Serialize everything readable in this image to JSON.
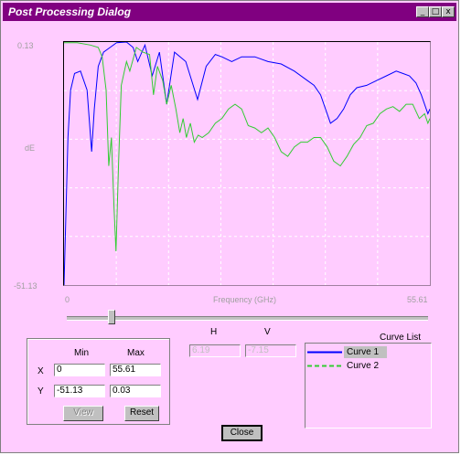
{
  "window": {
    "title": "Post Processing Dialog"
  },
  "titlebar_buttons": {
    "minimize": "_",
    "maximize": "□",
    "close": "x"
  },
  "plot": {
    "y_top_label": "0.13",
    "y_mid_label": "dE",
    "y_bottom_label": "-51.13",
    "x_left_label": "0",
    "x_title": "Frequency (GHz)",
    "x_right_label": "55.61",
    "colors": {
      "curve1": "#0000ff",
      "curve2": "#33cc33",
      "background": "#ffccff",
      "grid": "#ffffff"
    }
  },
  "chart_data": {
    "type": "line",
    "xlim": [
      0,
      55.61
    ],
    "ylim": [
      -51.13,
      0.13
    ],
    "grid": true,
    "series": [
      {
        "name": "Curve 1",
        "style": "solid",
        "color": "#0000ff",
        "points": [
          [
            0,
            -51.13
          ],
          [
            0.6,
            -20
          ],
          [
            1,
            -10
          ],
          [
            1.6,
            -6.5
          ],
          [
            2.5,
            -6
          ],
          [
            3.5,
            -10
          ],
          [
            4.2,
            -23
          ],
          [
            4.6,
            -14
          ],
          [
            5.2,
            -5
          ],
          [
            6,
            -2
          ],
          [
            7,
            -1
          ],
          [
            8,
            0
          ],
          [
            9.5,
            0.13
          ],
          [
            10.5,
            -1
          ],
          [
            11.2,
            -4
          ],
          [
            12.3,
            -0.5
          ],
          [
            13.4,
            -7
          ],
          [
            14.5,
            -2
          ],
          [
            15.6,
            -13
          ],
          [
            16.8,
            -2
          ],
          [
            18.5,
            -4
          ],
          [
            20.3,
            -12
          ],
          [
            21.6,
            -5
          ],
          [
            23,
            -2.5
          ],
          [
            24,
            -3
          ],
          [
            25.5,
            -4
          ],
          [
            27,
            -3
          ],
          [
            29,
            -3
          ],
          [
            31,
            -4
          ],
          [
            33,
            -4.5
          ],
          [
            35,
            -6
          ],
          [
            37,
            -8
          ],
          [
            38,
            -9
          ],
          [
            39,
            -11
          ],
          [
            40.5,
            -17
          ],
          [
            41.5,
            -16
          ],
          [
            42.5,
            -14
          ],
          [
            43.5,
            -11
          ],
          [
            44.5,
            -9.5
          ],
          [
            46,
            -9
          ],
          [
            47.5,
            -8
          ],
          [
            49,
            -7
          ],
          [
            50.5,
            -6
          ],
          [
            51.5,
            -6.5
          ],
          [
            52.5,
            -7
          ],
          [
            53.5,
            -8.5
          ],
          [
            54.3,
            -11
          ],
          [
            55.3,
            -15
          ],
          [
            55.61,
            -14
          ]
        ]
      },
      {
        "name": "Curve 2",
        "style": "dashed",
        "color": "#33cc33",
        "points": [
          [
            0,
            0
          ],
          [
            2,
            0
          ],
          [
            4,
            -0.5
          ],
          [
            5.2,
            -1
          ],
          [
            5.8,
            -3
          ],
          [
            6.4,
            -10
          ],
          [
            6.8,
            -26
          ],
          [
            7.2,
            -20
          ],
          [
            7.6,
            -35
          ],
          [
            7.9,
            -44
          ],
          [
            8.3,
            -25
          ],
          [
            8.7,
            -9
          ],
          [
            9.5,
            -4
          ],
          [
            10,
            -6
          ],
          [
            11,
            -1
          ],
          [
            12,
            -2
          ],
          [
            13,
            -2.5
          ],
          [
            13.6,
            -11
          ],
          [
            14.2,
            -5
          ],
          [
            15,
            -8
          ],
          [
            15.6,
            -13
          ],
          [
            16.3,
            -9
          ],
          [
            17,
            -14
          ],
          [
            17.6,
            -19
          ],
          [
            18.1,
            -16
          ],
          [
            18.6,
            -20
          ],
          [
            19.2,
            -17
          ],
          [
            19.8,
            -21
          ],
          [
            20.4,
            -19.5
          ],
          [
            21,
            -20
          ],
          [
            22,
            -19
          ],
          [
            23,
            -17
          ],
          [
            24,
            -16
          ],
          [
            25,
            -14
          ],
          [
            26,
            -13
          ],
          [
            27,
            -14
          ],
          [
            28,
            -17.5
          ],
          [
            29,
            -18
          ],
          [
            30,
            -19
          ],
          [
            31,
            -18
          ],
          [
            32,
            -20
          ],
          [
            33,
            -23
          ],
          [
            34,
            -24
          ],
          [
            35,
            -22
          ],
          [
            36,
            -21
          ],
          [
            37,
            -21
          ],
          [
            38,
            -20
          ],
          [
            39,
            -20
          ],
          [
            40,
            -22
          ],
          [
            41,
            -25
          ],
          [
            42,
            -26
          ],
          [
            43,
            -24
          ],
          [
            44,
            -21.5
          ],
          [
            45,
            -20
          ],
          [
            46,
            -17.5
          ],
          [
            47,
            -17
          ],
          [
            48,
            -15
          ],
          [
            49,
            -14
          ],
          [
            50,
            -13.5
          ],
          [
            51,
            -14.5
          ],
          [
            52,
            -13
          ],
          [
            53,
            -13
          ],
          [
            54,
            -16
          ],
          [
            54.8,
            -15
          ],
          [
            55.3,
            -17
          ],
          [
            55.61,
            -16
          ]
        ]
      }
    ]
  },
  "range_box": {
    "min_header": "Min",
    "max_header": "Max",
    "x_label": "X",
    "y_label": "Y",
    "x_min": "0",
    "x_max": "55.61",
    "y_min": "-51.13",
    "y_max": "0.03",
    "view_label": "View",
    "reset_label": "Reset"
  },
  "cursor": {
    "h_label": "H",
    "v_label": "V",
    "h_value": "6.19",
    "v_value": "-7.15"
  },
  "curve_list": {
    "title": "Curve List",
    "items": [
      {
        "label": "Curve 1",
        "selected": true
      },
      {
        "label": "Curve 2",
        "selected": false
      }
    ]
  },
  "close_label": "Close",
  "slider": {
    "position": 0.12
  }
}
